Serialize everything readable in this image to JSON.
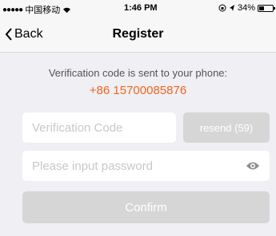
{
  "status_bar": {
    "carrier": "中国移动",
    "time": "1:46 PM",
    "battery": "34%",
    "signal_dots": "●●●●●"
  },
  "nav": {
    "back_label": "Back",
    "title": "Register"
  },
  "verification": {
    "info": "Verification code is sent to your phone:",
    "phone": "+86 15700085876"
  },
  "form": {
    "code_placeholder": "Verification Code",
    "resend_label": "resend (59)",
    "password_placeholder": "Please input password",
    "confirm_label": "Confirm"
  },
  "colors": {
    "accent": "#f0651f",
    "disabled": "#d6d6d6",
    "background": "#efeff4"
  },
  "icons": [
    "wifi-icon",
    "location-icon",
    "orientation-lock-icon",
    "battery-icon",
    "chevron-left-icon",
    "eye-icon"
  ]
}
